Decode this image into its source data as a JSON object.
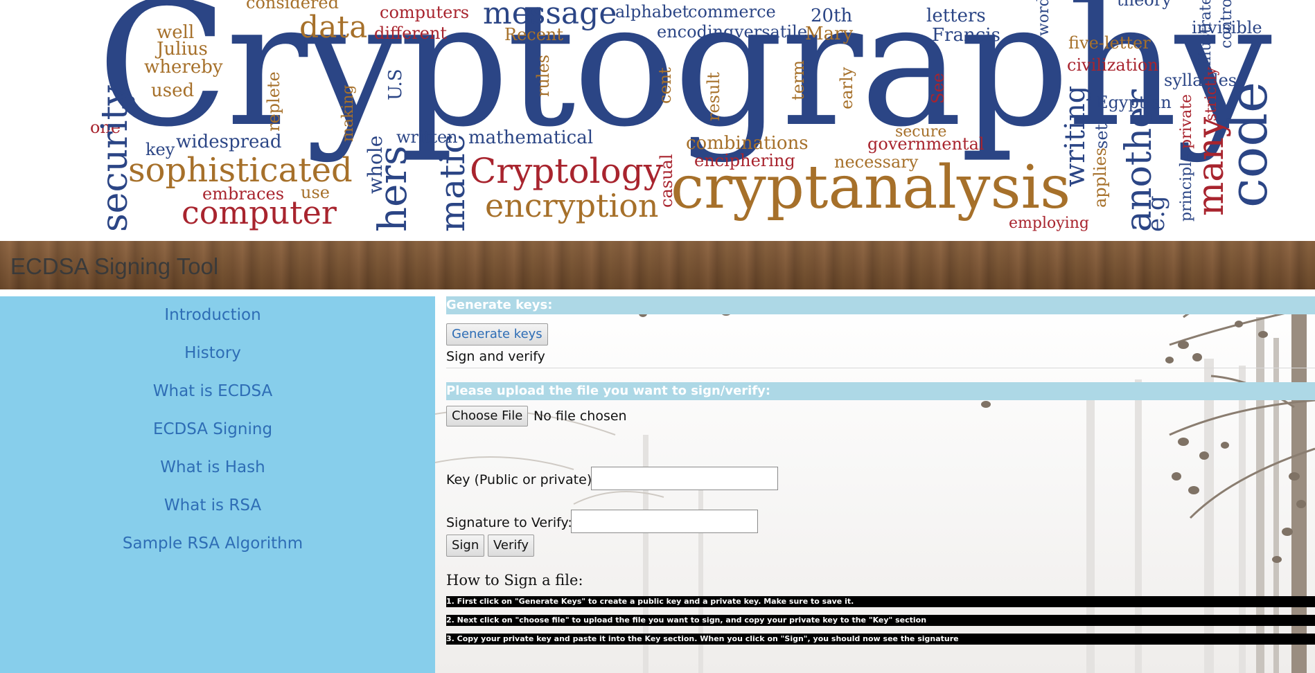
{
  "banner": {
    "title_word": "Cryptography",
    "words": [
      "considered",
      "computers",
      "message",
      "alphabet",
      "commerce",
      "20th",
      "letters",
      "theory",
      "well",
      "Julius",
      "whereby",
      "used",
      "data",
      "different",
      "Recent",
      "encoding",
      "versatile",
      "Mary",
      "Francis",
      "five-letter",
      "invisible",
      "civilization",
      "syllables",
      "Egyptian",
      "U.S",
      "rules",
      "cent",
      "result",
      "term",
      "early",
      "See",
      "one",
      "key",
      "widespread",
      "replete",
      "making",
      "written",
      "mathematical",
      "combinations",
      "enciphering",
      "secure",
      "governmental",
      "necessary",
      "writing",
      "set",
      "applies",
      "private",
      "strictly",
      "principle",
      "sophisticated",
      "embraces",
      "use",
      "computer",
      "Cryptology",
      "encryption",
      "casual",
      "cryptanalysis",
      "employing",
      "another",
      "many",
      "code",
      "e.g",
      "security",
      "whole",
      "hers",
      "matic",
      "illustrates",
      "control",
      "word"
    ]
  },
  "header": {
    "title": "ECDSA Signing Tool"
  },
  "sidebar": {
    "items": [
      {
        "label": "Introduction"
      },
      {
        "label": "History"
      },
      {
        "label": "What is ECDSA"
      },
      {
        "label": "ECDSA Signing"
      },
      {
        "label": "What is Hash"
      },
      {
        "label": "What is RSA"
      },
      {
        "label": "Sample RSA Algorithm"
      }
    ]
  },
  "main": {
    "generate_heading": "Generate keys:",
    "generate_button": "Generate keys",
    "sign_verify_label": "Sign and verify",
    "upload_heading": "Please upload the file you want to sign/verify:",
    "choose_file_button": "Choose File",
    "no_file_text": "No file chosen",
    "key_label": "Key (Public or private):",
    "key_value": "",
    "signature_label": "Signature to Verify:",
    "signature_value": "",
    "sign_button": "Sign",
    "verify_button": "Verify",
    "howto_title": "How to Sign a file:",
    "steps": [
      "1. First click on \"Generate Keys\" to create a public key and a private key. Make sure to save it.",
      "2. Next click on \"choose file\" to upload the file you want to sign, and copy your private key to the \"Key\" section",
      "3. Copy your private key and paste it into the Key section. When you click on \"Sign\", you should now see the signature"
    ]
  },
  "colors": {
    "sidebar_bg": "#87ceeb",
    "nav_link": "#2e6db5",
    "section_head_bg": "#add8e6",
    "header_wood": "#7a5230",
    "word_navy": "#2b4585",
    "word_red": "#a8242e",
    "word_gold": "#a6702a"
  }
}
